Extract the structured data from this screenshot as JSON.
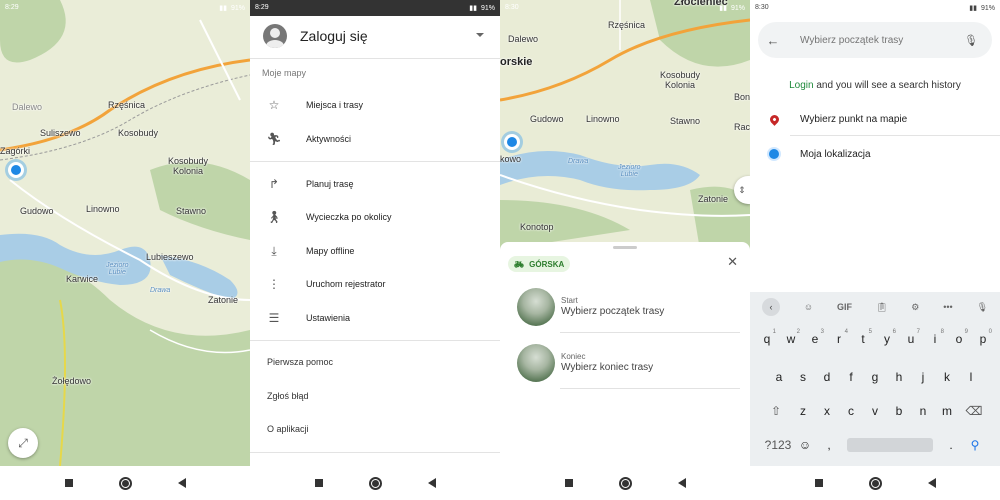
{
  "screens": [
    {
      "status": {
        "time": "8:29",
        "battery": "91%"
      },
      "map_labels": {
        "zagorki": "Zagórki",
        "dalewo": "Dalewo",
        "rzesnica": "Rzęśnica",
        "suliszewo": "Suliszewo",
        "kosobudy": "Kosobudy",
        "kosobudy_kolonia": "Kosobudy\nKolonia",
        "gudowo": "Gudowo",
        "linowno": "Linowno",
        "stawno": "Stawno",
        "lubieszewo": "Lubieszewo",
        "karwice": "Karwice",
        "jezioro_lubie": "Jezioro\nLubie",
        "drawa": "Drawa",
        "zatonie": "Zatonie",
        "zoledowo": "Żołędowo"
      }
    },
    {
      "status": {
        "time": "8:29",
        "battery": "91%"
      },
      "login_title": "Zaloguj się",
      "section_title": "Moje mapy",
      "menu_items": [
        {
          "label": "Miejsca i trasy",
          "icon": "star-icon"
        },
        {
          "label": "Aktywności",
          "icon": "running-icon"
        },
        {
          "label": "Planuj trasę",
          "icon": "route-icon"
        },
        {
          "label": "Wycieczka po okolicy",
          "icon": "hiking-icon"
        },
        {
          "label": "Mapy offline",
          "icon": "download-icon"
        },
        {
          "label": "Uruchom rejestrator",
          "icon": "footsteps-icon"
        },
        {
          "label": "Ustawienia",
          "icon": "sliders-icon"
        }
      ],
      "plain_items": [
        "Pierwsza pomoc",
        "Zgłoś błąd",
        "O aplikacji"
      ]
    },
    {
      "status": {
        "time": "8:30",
        "battery": "91%"
      },
      "map_labels": {
        "rzesnica": "Rzęśnica",
        "dalewo": "Dalewo",
        "orskie": "orskie",
        "kosobudy_kolonia": "Kosobudy\nKolonia",
        "bon": "Bon",
        "gudowo": "Gudowo",
        "linowno": "Linowno",
        "stawno": "Stawno",
        "rac": "Rac",
        "kowo": "kowo",
        "drawa": "Drawa",
        "jezioro_lubie": "Jezioro\nLubie",
        "zatonie": "Zatonie",
        "konotop": "Konotop",
        "zlocieniec": "Złocieniec"
      },
      "route": {
        "mode": "GÓRSKA",
        "start_small": "Start",
        "start_main": "Wybierz początek trasy",
        "end_small": "Koniec",
        "end_main": "Wybierz koniec trasy"
      }
    },
    {
      "status": {
        "time": "8:30",
        "battery": "91%"
      },
      "search_placeholder": "Wybierz początek trasy",
      "hint_link": "Login",
      "hint_text": " and you will see a search history",
      "options": [
        "Wybierz punkt na mapie",
        "Moja lokalizacja"
      ],
      "keyboard": {
        "tools": [
          "GIF"
        ],
        "row1": [
          "q",
          "w",
          "e",
          "r",
          "t",
          "y",
          "u",
          "i",
          "o",
          "p"
        ],
        "row1_sup": [
          "1",
          "2",
          "3",
          "4",
          "5",
          "6",
          "7",
          "8",
          "9",
          "0"
        ],
        "row2": [
          "a",
          "s",
          "d",
          "f",
          "g",
          "h",
          "j",
          "k",
          "l"
        ],
        "row3": [
          "z",
          "x",
          "c",
          "v",
          "b",
          "n",
          "m"
        ],
        "num_key": "?123",
        "comma": ",",
        "period": "."
      }
    }
  ],
  "colors": {
    "accent_green": "#1e8a3b",
    "location_blue": "#1e88e5",
    "pin_red": "#c62828"
  }
}
